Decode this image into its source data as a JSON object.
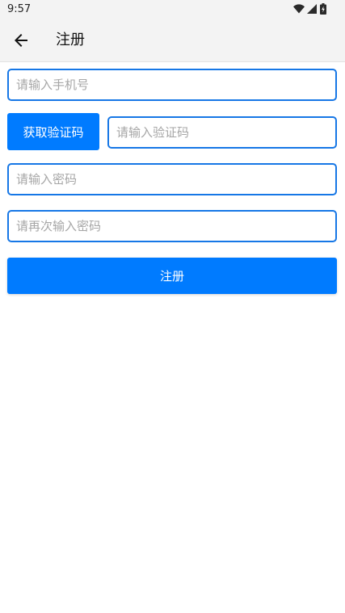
{
  "status_bar": {
    "time": "9:57",
    "icons": [
      "wifi-icon",
      "cell-signal-icon",
      "battery-icon"
    ]
  },
  "app_bar": {
    "back_icon": "arrow-left-icon",
    "title": "注册"
  },
  "form": {
    "phone": {
      "value": "",
      "placeholder": "请输入手机号"
    },
    "get_code_label": "获取验证码",
    "code": {
      "value": "",
      "placeholder": "请输入验证码"
    },
    "password": {
      "value": "",
      "placeholder": "请输入密码"
    },
    "confirm_password": {
      "value": "",
      "placeholder": "请再次输入密码"
    },
    "register_label": "注册"
  },
  "colors": {
    "accent": "#007bff",
    "field_border": "#1677e6",
    "bar_background": "#f3f3f3",
    "placeholder": "#a6a6a6"
  }
}
